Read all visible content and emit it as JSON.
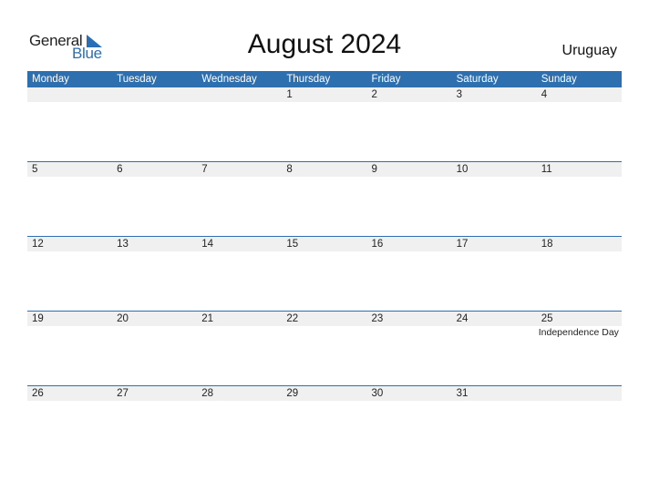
{
  "logo": {
    "word1": "General",
    "word2": "Blue",
    "icon": "blue-triangle-icon"
  },
  "title": "August 2024",
  "country": "Uruguay",
  "colors": {
    "accent": "#2e6fb0",
    "day_row_bg": "#f0f0f0"
  },
  "weekdays": [
    "Monday",
    "Tuesday",
    "Wednesday",
    "Thursday",
    "Friday",
    "Saturday",
    "Sunday"
  ],
  "weeks": [
    {
      "days": [
        "",
        "",
        "",
        "1",
        "2",
        "3",
        "4"
      ],
      "events": [
        "",
        "",
        "",
        "",
        "",
        "",
        ""
      ]
    },
    {
      "days": [
        "5",
        "6",
        "7",
        "8",
        "9",
        "10",
        "11"
      ],
      "events": [
        "",
        "",
        "",
        "",
        "",
        "",
        ""
      ]
    },
    {
      "days": [
        "12",
        "13",
        "14",
        "15",
        "16",
        "17",
        "18"
      ],
      "events": [
        "",
        "",
        "",
        "",
        "",
        "",
        ""
      ]
    },
    {
      "days": [
        "19",
        "20",
        "21",
        "22",
        "23",
        "24",
        "25"
      ],
      "events": [
        "",
        "",
        "",
        "",
        "",
        "",
        "Independence Day"
      ]
    },
    {
      "days": [
        "26",
        "27",
        "28",
        "29",
        "30",
        "31",
        ""
      ],
      "events": [
        "",
        "",
        "",
        "",
        "",
        "",
        ""
      ]
    }
  ]
}
